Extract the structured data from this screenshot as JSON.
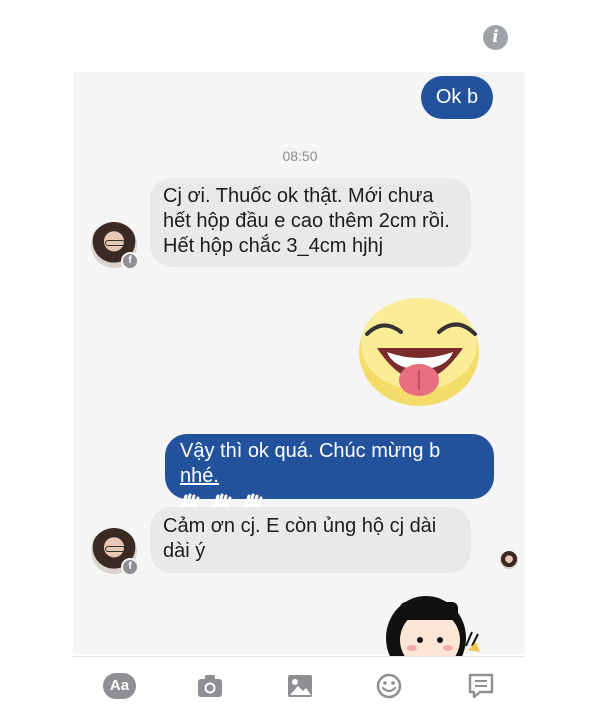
{
  "header": {
    "info_icon": "info-icon"
  },
  "messages": {
    "ok_b": "Ok b",
    "timestamp": "08:50",
    "incoming_1": "Cj ơi. Thuốc ok thật. Mới chưa hết hộp đầu e cao thêm 2cm rồi. Hết hộp chắc 3_4cm hjhj",
    "outgoing_2_main": "Vậy thì ok quá. Chúc mừng b ",
    "outgoing_2_link": "nhé.",
    "outgoing_2_emoji": "waving-hand-icon",
    "incoming_3": "Cảm ơn cj. E còn ủng hộ cj dài dài ý"
  },
  "composer": {
    "aa_label": "Aa",
    "icons": [
      "camera-icon",
      "gallery-icon",
      "emoji-icon",
      "more-icon"
    ]
  },
  "colors": {
    "outgoing_bubble": "#22529b",
    "incoming_bubble": "#e9e9ea",
    "panel_bg": "#f5f5f6",
    "icon_gray": "#8e8e93"
  }
}
